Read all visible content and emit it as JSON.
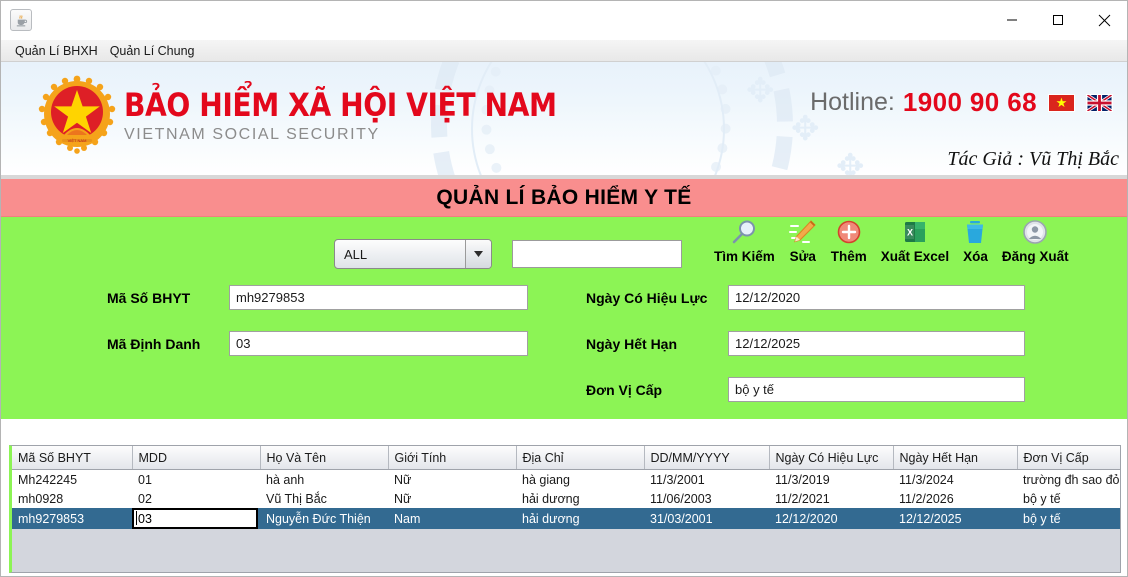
{
  "window": {
    "app_icon": "java-coffee-cup-icon",
    "minimize_label": "minimize-icon",
    "maximize_label": "maximize-icon",
    "close_label": "close-icon"
  },
  "menubar": {
    "items": [
      {
        "label": "Quản Lí BHXH"
      },
      {
        "label": "Quản Lí Chung"
      }
    ]
  },
  "banner": {
    "emblem": "vietnam-national-emblem",
    "title": "BẢO HIỂM XÃ HỘI VIỆT NAM",
    "subtitle": "VIETNAM SOCIAL SECURITY",
    "hotline_label": "Hotline:",
    "hotline_number": "1900 90 68",
    "flag_vn": "vietnam-flag",
    "flag_uk": "united-kingdom-flag",
    "author": "Tác Giả : Vũ Thị Bắc"
  },
  "page": {
    "title": "QUẢN LÍ BẢO HIỂM Y TẾ"
  },
  "search": {
    "filter_selected": "ALL",
    "query_value": "",
    "query_placeholder": ""
  },
  "toolbar": {
    "buttons": [
      {
        "label": "Tìm Kiếm",
        "icon": "magnifier-icon"
      },
      {
        "label": "Sửa",
        "icon": "pencil-icon"
      },
      {
        "label": "Thêm",
        "icon": "plus-circle-icon"
      },
      {
        "label": "Xuất Excel",
        "icon": "excel-icon"
      },
      {
        "label": "Xóa",
        "icon": "trash-icon"
      },
      {
        "label": "Đăng Xuất",
        "icon": "user-logout-icon"
      }
    ]
  },
  "form": {
    "ma_so_bhyt": {
      "label": "Mã Số BHYT",
      "value": "mh9279853"
    },
    "ma_dinh_danh": {
      "label": "Mã Định Danh",
      "value": "03"
    },
    "ngay_co_hieu_luc": {
      "label": "Ngày Có Hiệu Lực",
      "value": "12/12/2020"
    },
    "ngay_het_han": {
      "label": "Ngày Hết Hạn",
      "value": "12/12/2025"
    },
    "don_vi_cap": {
      "label": "Đơn Vị Cấp",
      "value": "bộ y tế"
    }
  },
  "table": {
    "columns": [
      "Mã Số BHYT",
      "MDD",
      "Họ Và Tên",
      "Giới Tính",
      "Địa Chỉ",
      "DD/MM/YYYY",
      "Ngày Có Hiệu Lực",
      "Ngày Hết Hạn",
      "Đơn Vị Cấp"
    ],
    "rows": [
      {
        "selected": false,
        "editing_cell": -1,
        "cells": [
          "Mh242245",
          "01",
          "hà anh",
          "Nữ",
          "hà giang",
          "11/3/2001",
          "11/3/2019",
          "11/3/2024",
          "trường đh sao đỏ"
        ]
      },
      {
        "selected": false,
        "editing_cell": -1,
        "cells": [
          "mh0928",
          "02",
          "Vũ Thị Bắc",
          "Nữ",
          "hải dương",
          "11/06/2003",
          "11/2/2021",
          "11/2/2026",
          "bộ y tế"
        ]
      },
      {
        "selected": true,
        "editing_cell": 1,
        "cells": [
          "mh9279853",
          "03",
          "Nguyễn Đức Thiện",
          "Nam",
          "hải dương",
          "31/03/2001",
          "12/12/2020",
          "12/12/2025",
          "bộ y tế"
        ]
      }
    ]
  },
  "colors": {
    "panel_green": "#8cf455",
    "title_pink": "#f98e8e",
    "brand_red": "#e3081c",
    "selection_blue": "#336a91",
    "table_empty": "#d3d6dd"
  }
}
